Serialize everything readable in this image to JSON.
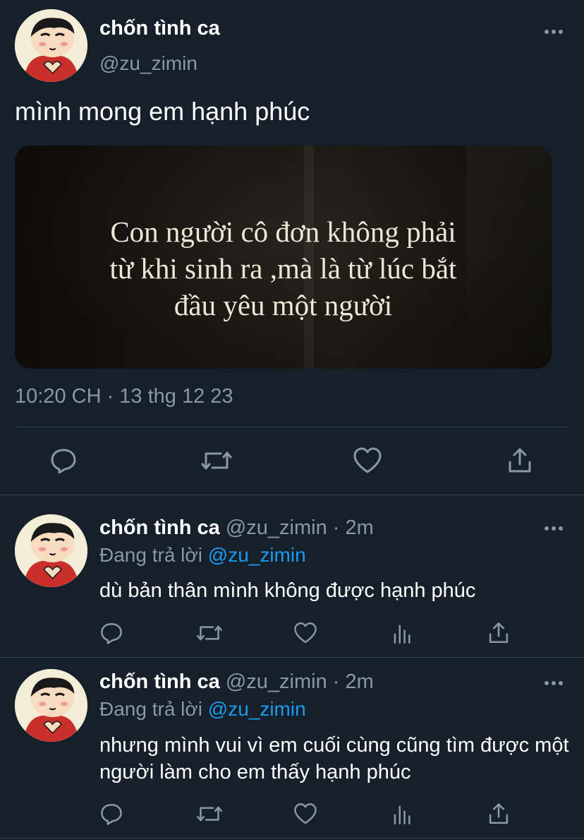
{
  "colors": {
    "background": "#15202b",
    "text": "#ffffff",
    "secondary_text": "#8899a6",
    "mention": "#1d9bf0",
    "divider": "#38444d"
  },
  "main_tweet": {
    "display_name": "chốn tình ca",
    "handle": "@zu_zimin",
    "text": "mình mong em hạnh phúc",
    "image_text": {
      "line1": "Con người cô đơn không phải",
      "line2": "từ khi sinh ra ,mà là từ lúc bắt",
      "line3": "đầu yêu một người"
    },
    "timestamp": "10:20 CH · 13 thg 12 23",
    "icons": [
      "reply-icon",
      "retweet-icon",
      "like-icon",
      "share-icon"
    ]
  },
  "replies": [
    {
      "display_name": "chốn tình ca",
      "meta": " @zu_zimin · 2m",
      "replying_prefix": "Đang trả lời ",
      "replying_to": "@zu_zimin",
      "text": "dù bản thân mình không được hạnh phúc",
      "icons": [
        "reply-icon",
        "retweet-icon",
        "like-icon",
        "views-icon",
        "share-icon"
      ]
    },
    {
      "display_name": "chốn tình ca",
      "meta": " @zu_zimin · 2m",
      "replying_prefix": "Đang trả lời ",
      "replying_to": "@zu_zimin",
      "text": "nhưng mình vui vì em cuối cùng cũng tìm được một người làm cho em thấy hạnh phúc",
      "icons": [
        "reply-icon",
        "retweet-icon",
        "like-icon",
        "views-icon",
        "share-icon"
      ]
    }
  ]
}
